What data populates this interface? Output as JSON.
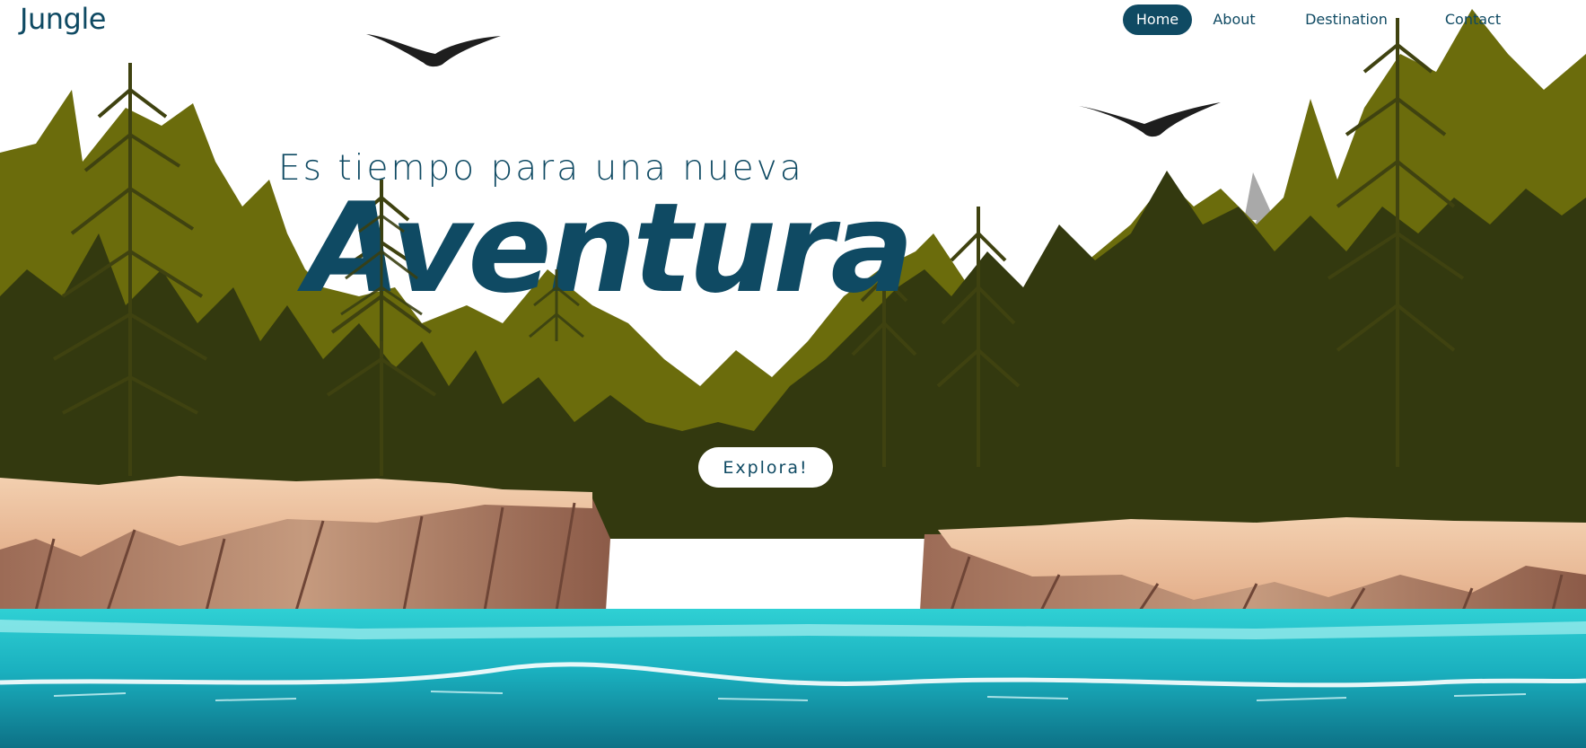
{
  "logo": "Jungle",
  "nav": {
    "items": [
      {
        "label": "Home",
        "active": true
      },
      {
        "label": "About",
        "active": false
      },
      {
        "label": "Destination",
        "active": false
      },
      {
        "label": "Contact",
        "active": false
      }
    ]
  },
  "hero": {
    "subtitle": "Es tiempo para una nueva",
    "title": "Aventura",
    "button_label": "Explora!"
  },
  "colors": {
    "primary": "#0f4a63",
    "pine_dark": "#33390f",
    "pine_olive": "#6b6c0c",
    "cliff": "#b98a70",
    "water": "#19aeba"
  }
}
